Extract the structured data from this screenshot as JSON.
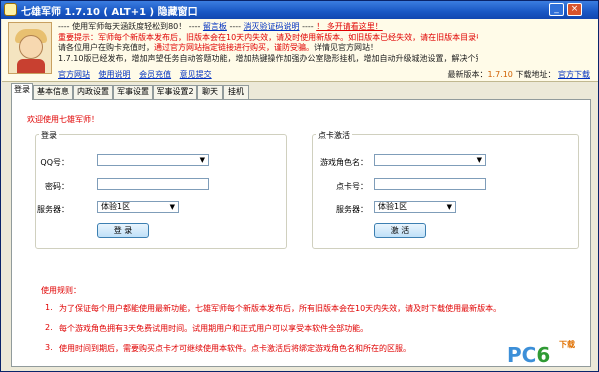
{
  "window": {
    "title": "七雄军师 1.7.10 ( ALT+1 ) 隐藏窗口",
    "minimize_label": "_",
    "close_label": "×"
  },
  "header": {
    "line1_a": "---- 使用军师每天涵跃度轻松到80！ ----",
    "line1_b": "留言板",
    "line1_c": "----",
    "line1_d": "消灭验证码说明",
    "line1_e": "----",
    "line1_f": "！ 多开请看这里！",
    "line2_a": "重要提示：",
    "line2_b": "军师每个新版本发布后，旧版本会在10天内失效，请及时使用新版本。如旧版本已经失效，请在旧版本目录中寻找下载链接",
    "line3_a": "请各位用户在购卡充值时，",
    "line3_b": "通过官方网站指定链接进行购买，谨防受骗。",
    "line3_c": "详情见官方网站！",
    "line4": "1.7.10版已经发布，增加声望任务自动答题功能，增加热键操作加强办公室隐形挂机，增加自动升级城池设置，解决个别区服登录问题，欢迎下载！",
    "links": [
      "官方网站",
      "使用说明",
      "会员充值",
      "意见提交"
    ],
    "latest_label": "最新版本：",
    "latest_version": "1.7.10",
    "download_label": "下载地址：",
    "download_link": "官方下载"
  },
  "tabs": [
    "登录",
    "基本信息",
    "内政设置",
    "军事设置",
    "军事设置2",
    "聊天",
    "挂机"
  ],
  "welcome": "欢迎使用七雄军师！",
  "login": {
    "group_title": "登录",
    "qq_label": "QQ号：",
    "qq_value": "",
    "password_label": "密码：",
    "password_value": "",
    "server_label": "服务器：",
    "server_value": "体验1区",
    "button": "登 录"
  },
  "card": {
    "group_title": "点卡激活",
    "role_label": "游戏角色名：",
    "role_value": "",
    "card_label": "点卡号：",
    "card_value": "",
    "server_label": "服务器：",
    "server_value": "体验1区",
    "button": "激 活"
  },
  "rules": {
    "title": "使用规则：",
    "items": [
      {
        "num": "1.",
        "text": "为了保证每个用户都能使用最新功能，七雄军师每个新版本发布后，所有旧版本会在10天内失效，请及时下载使用最新版本。"
      },
      {
        "num": "2.",
        "text": "每个游戏角色拥有3天免费试用时间。试用期用户和正式用户可以享受本软件全部功能。"
      },
      {
        "num": "3.",
        "text": "使用时间到期后，需要购买点卡才可继续使用本软件。点卡激活后将绑定游戏角色名和所在的区服。"
      }
    ]
  },
  "watermark": {
    "pc": "PC",
    "six": "6",
    "small": "下载"
  }
}
